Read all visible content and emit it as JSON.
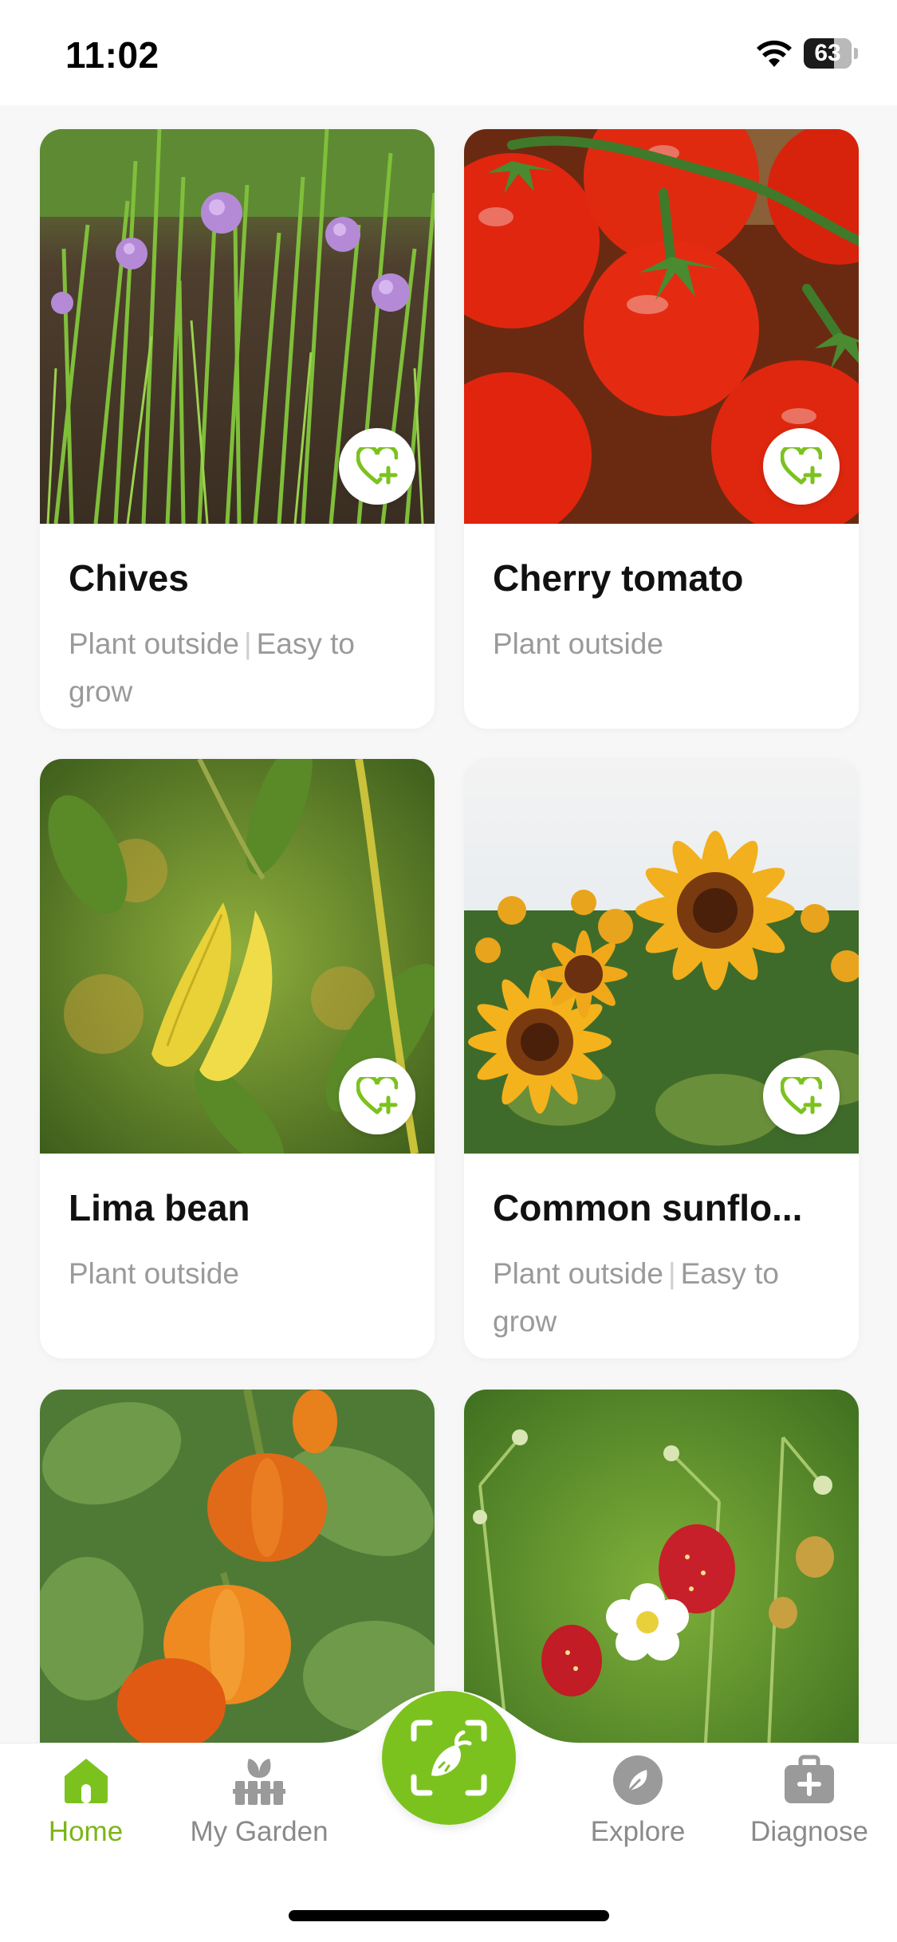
{
  "status_bar": {
    "time": "11:02",
    "battery": "63",
    "battery_level": 0.63
  },
  "plants": [
    {
      "name": "Chives",
      "tags": [
        "Plant outside",
        "Easy to grow"
      ],
      "image": "chives-flowers"
    },
    {
      "name": "Cherry tomato",
      "tags": [
        "Plant outside"
      ],
      "image": "cherry-tomatoes"
    },
    {
      "name": "Lima bean",
      "tags": [
        "Plant outside"
      ],
      "image": "lima-bean-pods"
    },
    {
      "name": "Common sunflo...",
      "tags": [
        "Plant outside",
        "Easy to grow"
      ],
      "image": "sunflowers"
    },
    {
      "name": "",
      "tags": [],
      "image": "orange-peppers"
    },
    {
      "name": "",
      "tags": [],
      "image": "wild-strawberries"
    }
  ],
  "tab_bar": {
    "tabs": [
      {
        "label": "Home",
        "icon": "home-icon",
        "active": true
      },
      {
        "label": "My Garden",
        "icon": "garden-icon",
        "active": false
      },
      {
        "label": "Explore",
        "icon": "compass-icon",
        "active": false
      },
      {
        "label": "Diagnose",
        "icon": "medkit-icon",
        "active": false
      }
    ],
    "scan_icon": "scan-plant-icon"
  },
  "colors": {
    "accent": "#7cc21f",
    "accent_text": "#7cb518",
    "muted": "#9a9a9a"
  },
  "icons": {
    "favorite": "heart-plus-icon"
  }
}
